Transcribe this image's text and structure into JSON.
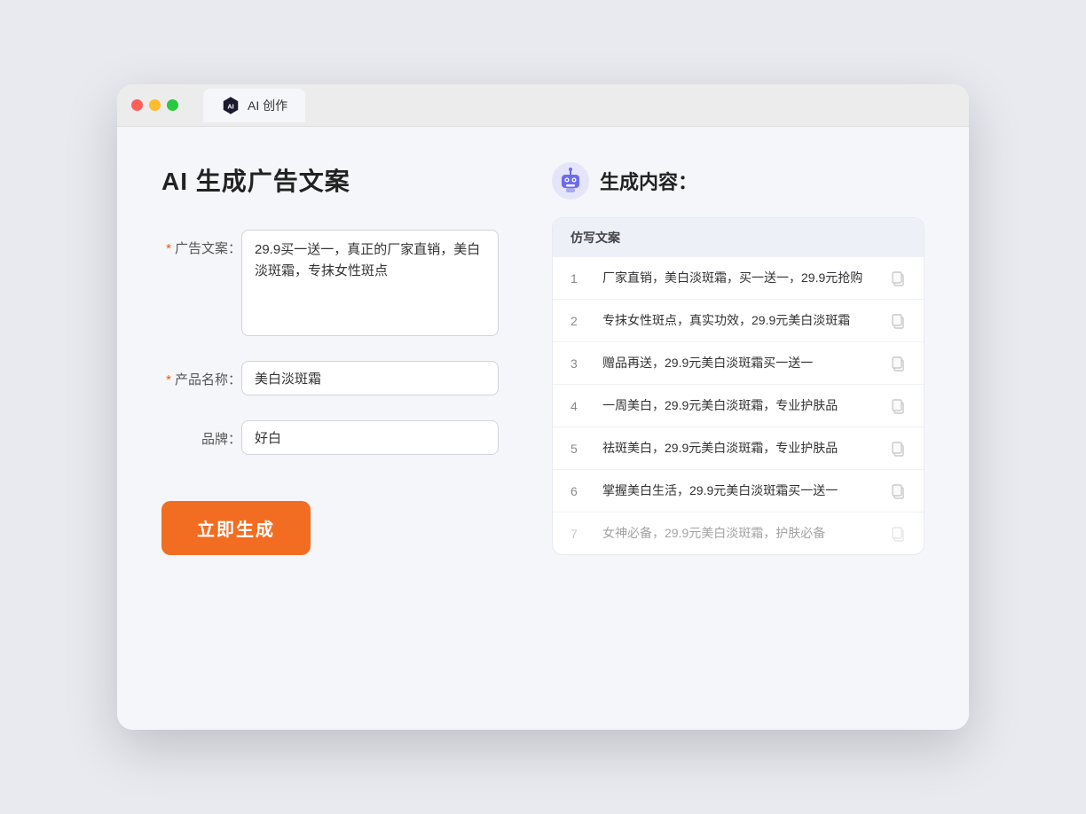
{
  "window": {
    "tab_label": "AI 创作"
  },
  "left_panel": {
    "page_title": "AI 生成广告文案",
    "fields": [
      {
        "label": "广告文案：",
        "required": true,
        "type": "textarea",
        "value": "29.9买一送一，真正的厂家直销，美白淡斑霜，专抹女性斑点",
        "name": "ad-copy-input"
      },
      {
        "label": "产品名称：",
        "required": true,
        "type": "input",
        "value": "美白淡斑霜",
        "name": "product-name-input"
      },
      {
        "label": "品牌：",
        "required": false,
        "type": "input",
        "value": "好白",
        "name": "brand-input"
      }
    ],
    "button_label": "立即生成"
  },
  "right_panel": {
    "title": "生成内容：",
    "column_header": "仿写文案",
    "results": [
      {
        "num": 1,
        "text": "厂家直销，美白淡斑霜，买一送一，29.9元抢购",
        "dimmed": false
      },
      {
        "num": 2,
        "text": "专抹女性斑点，真实功效，29.9元美白淡斑霜",
        "dimmed": false
      },
      {
        "num": 3,
        "text": "赠品再送，29.9元美白淡斑霜买一送一",
        "dimmed": false
      },
      {
        "num": 4,
        "text": "一周美白，29.9元美白淡斑霜，专业护肤品",
        "dimmed": false
      },
      {
        "num": 5,
        "text": "祛斑美白，29.9元美白淡斑霜，专业护肤品",
        "dimmed": false
      },
      {
        "num": 6,
        "text": "掌握美白生活，29.9元美白淡斑霜买一送一",
        "dimmed": false
      },
      {
        "num": 7,
        "text": "女神必备，29.9元美白淡斑霜，护肤必备",
        "dimmed": true
      }
    ]
  }
}
